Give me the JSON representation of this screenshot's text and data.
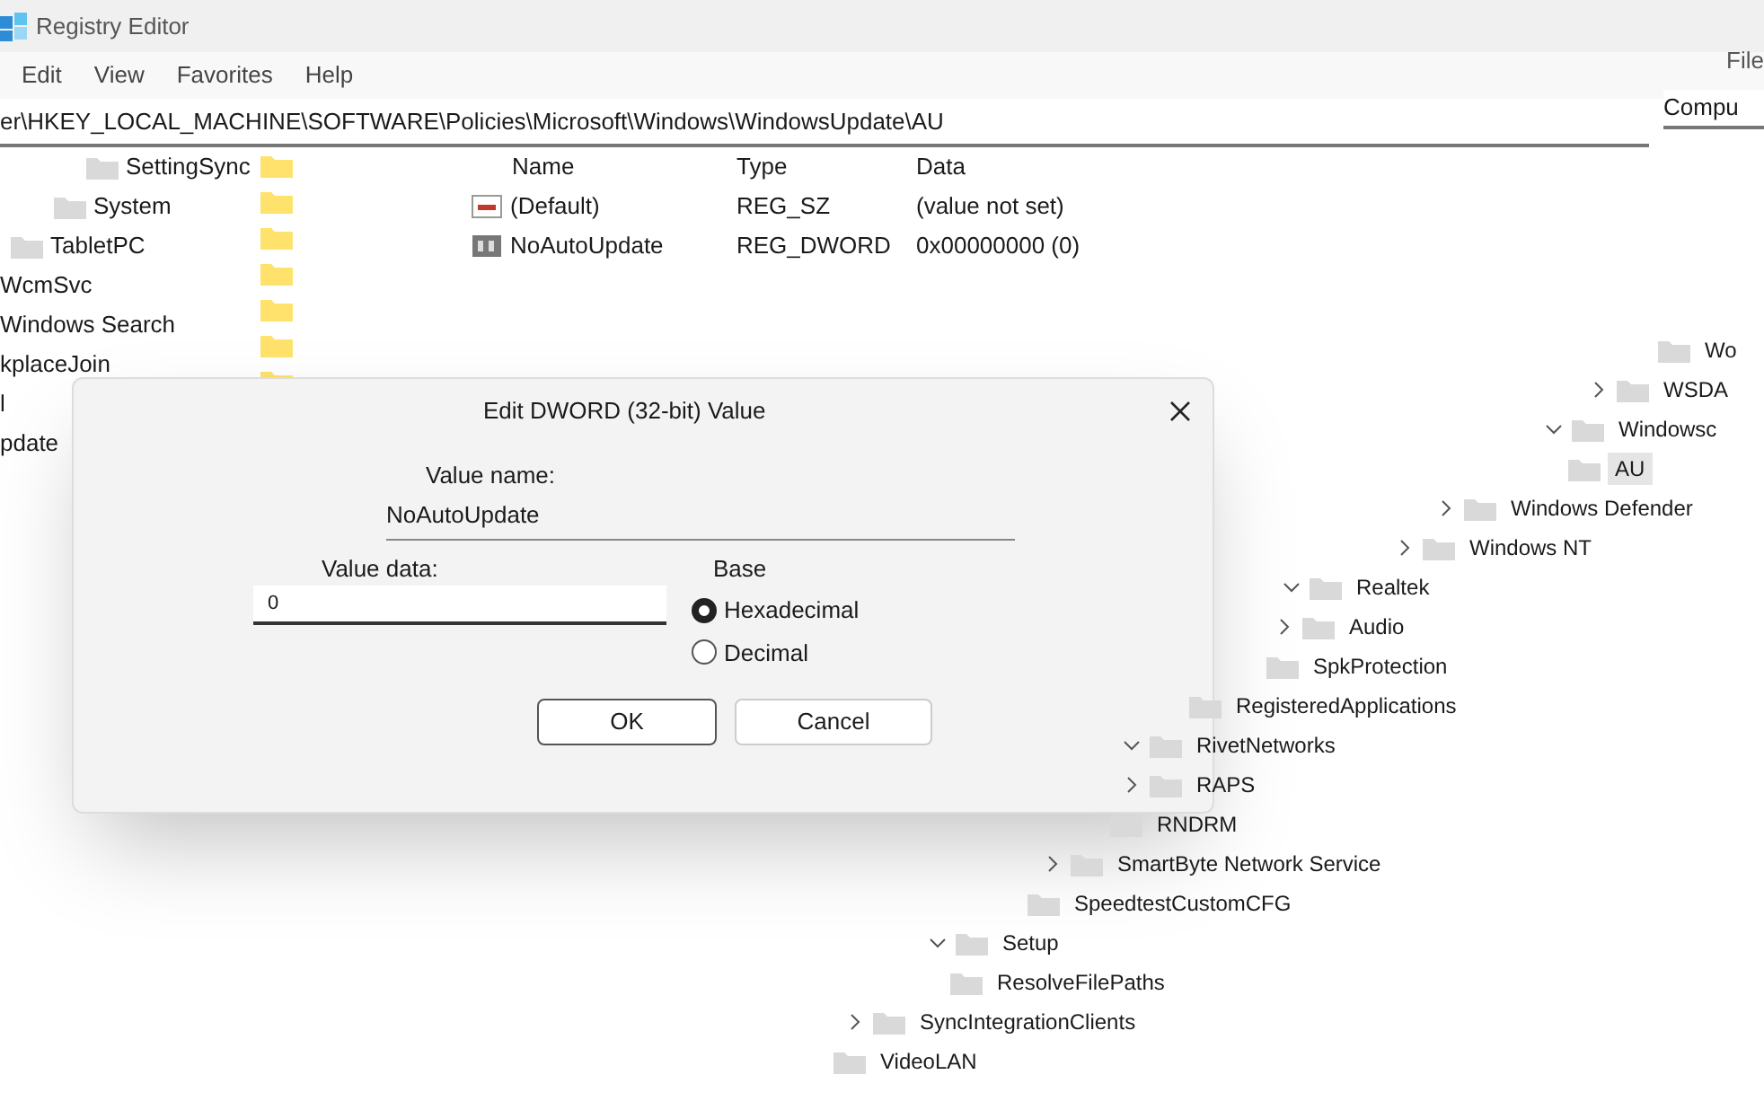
{
  "window": {
    "title": "Registry Editor"
  },
  "menu": [
    "Edit",
    "View",
    "Favorites",
    "Help"
  ],
  "address": "er\\HKEY_LOCAL_MACHINE\\SOFTWARE\\Policies\\Microsoft\\Windows\\WindowsUpdate\\AU",
  "left_tree": [
    {
      "label": "SettingSync"
    },
    {
      "label": "System"
    },
    {
      "label": "TabletPC"
    },
    {
      "label": "WcmSvc"
    },
    {
      "label": "Windows Search"
    },
    {
      "label": "kplaceJoin"
    },
    {
      "label": "l"
    },
    {
      "label": "pdate"
    }
  ],
  "values": {
    "columns": [
      "Name",
      "Type",
      "Data"
    ],
    "rows": [
      {
        "kind": "string",
        "name": "(Default)",
        "type": "REG_SZ",
        "data": "(value not set)"
      },
      {
        "kind": "binary",
        "name": "NoAutoUpdate",
        "type": "REG_DWORD",
        "data": "0x00000000 (0)"
      }
    ]
  },
  "dialog": {
    "title": "Edit DWORD (32-bit) Value",
    "value_name_label": "Value name:",
    "value_name": "NoAutoUpdate",
    "value_data_label": "Value data:",
    "value_data": "0",
    "base_label": "Base",
    "bases": [
      {
        "label": "Hexadecimal",
        "selected": true
      },
      {
        "label": "Decimal",
        "selected": false
      }
    ],
    "buttons": [
      "OK",
      "Cancel"
    ]
  },
  "right_window": {
    "menu": "File",
    "address": "Compu",
    "tree": [
      {
        "label": "Wo",
        "has_children": false,
        "selected": false
      },
      {
        "label": "WSDA",
        "has_children": true,
        "expanded": false,
        "selected": false
      },
      {
        "label": "Windowsc",
        "has_children": true,
        "expanded": true,
        "selected": false
      },
      {
        "label": "AU",
        "has_children": false,
        "selected": true
      },
      {
        "label": "Windows Defender",
        "has_children": true,
        "expanded": false,
        "selected": false
      },
      {
        "label": "Windows NT",
        "has_children": true,
        "expanded": false,
        "selected": false
      },
      {
        "label": "Realtek",
        "has_children": true,
        "expanded": true,
        "selected": false
      },
      {
        "label": "Audio",
        "has_children": true,
        "expanded": false,
        "selected": false
      },
      {
        "label": "SpkProtection",
        "has_children": false,
        "selected": false
      },
      {
        "label": "RegisteredApplications",
        "has_children": false,
        "selected": false
      },
      {
        "label": "RivetNetworks",
        "has_children": true,
        "expanded": true,
        "selected": false
      },
      {
        "label": "RAPS",
        "has_children": true,
        "expanded": false,
        "selected": false
      },
      {
        "label": "RNDRM",
        "has_children": false,
        "selected": false
      },
      {
        "label": "SmartByte Network Service",
        "has_children": true,
        "expanded": false,
        "selected": false
      },
      {
        "label": "SpeedtestCustomCFG",
        "has_children": false,
        "selected": false
      },
      {
        "label": "Setup",
        "has_children": true,
        "expanded": true,
        "selected": false
      },
      {
        "label": "ResolveFilePaths",
        "has_children": false,
        "selected": false
      },
      {
        "label": "SyncIntegrationClients",
        "has_children": true,
        "expanded": false,
        "selected": false
      },
      {
        "label": "VideoLAN",
        "has_children": false,
        "selected": false
      }
    ]
  }
}
